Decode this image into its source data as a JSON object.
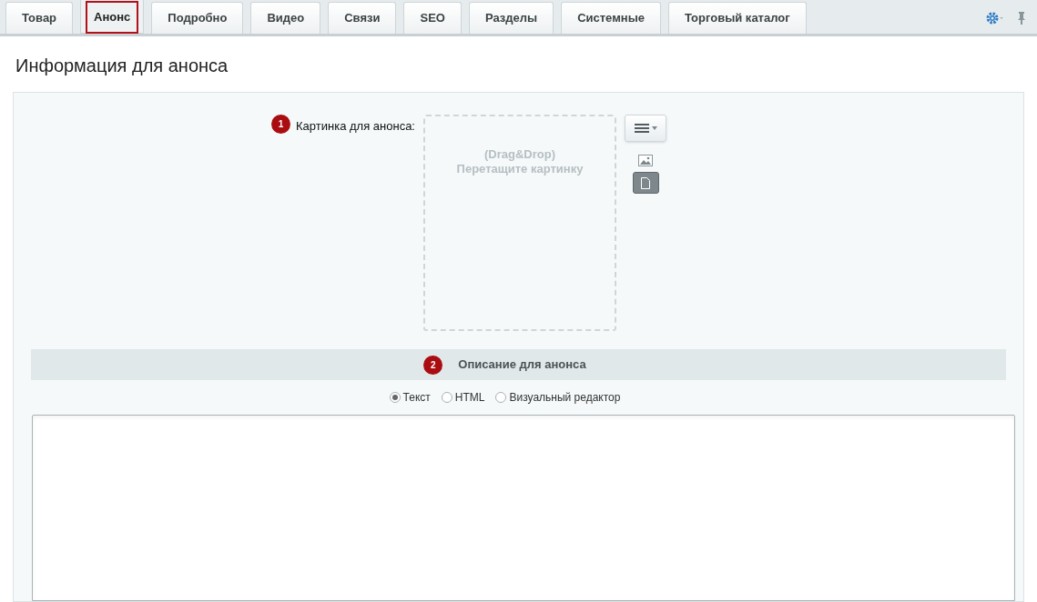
{
  "tabs": [
    {
      "label": "Товар",
      "selected": false
    },
    {
      "label": "Анонс",
      "selected": true
    },
    {
      "label": "Подробно",
      "selected": false
    },
    {
      "label": "Видео",
      "selected": false
    },
    {
      "label": "Связи",
      "selected": false
    },
    {
      "label": "SEO",
      "selected": false
    },
    {
      "label": "Разделы",
      "selected": false
    },
    {
      "label": "Системные",
      "selected": false
    },
    {
      "label": "Торговый каталог",
      "selected": false
    }
  ],
  "heading": "Информация для анонса",
  "image_field": {
    "badge": "1",
    "label": "Картинка для анонса:",
    "drop_line_1": "(Drag&Drop)",
    "drop_line_2": "Перетащите картинку"
  },
  "description": {
    "badge": "2",
    "title": "Описание для анонса",
    "modes": [
      {
        "label": "Текст",
        "selected": true
      },
      {
        "label": "HTML",
        "selected": false
      },
      {
        "label": "Визуальный редактор",
        "selected": false
      }
    ]
  }
}
